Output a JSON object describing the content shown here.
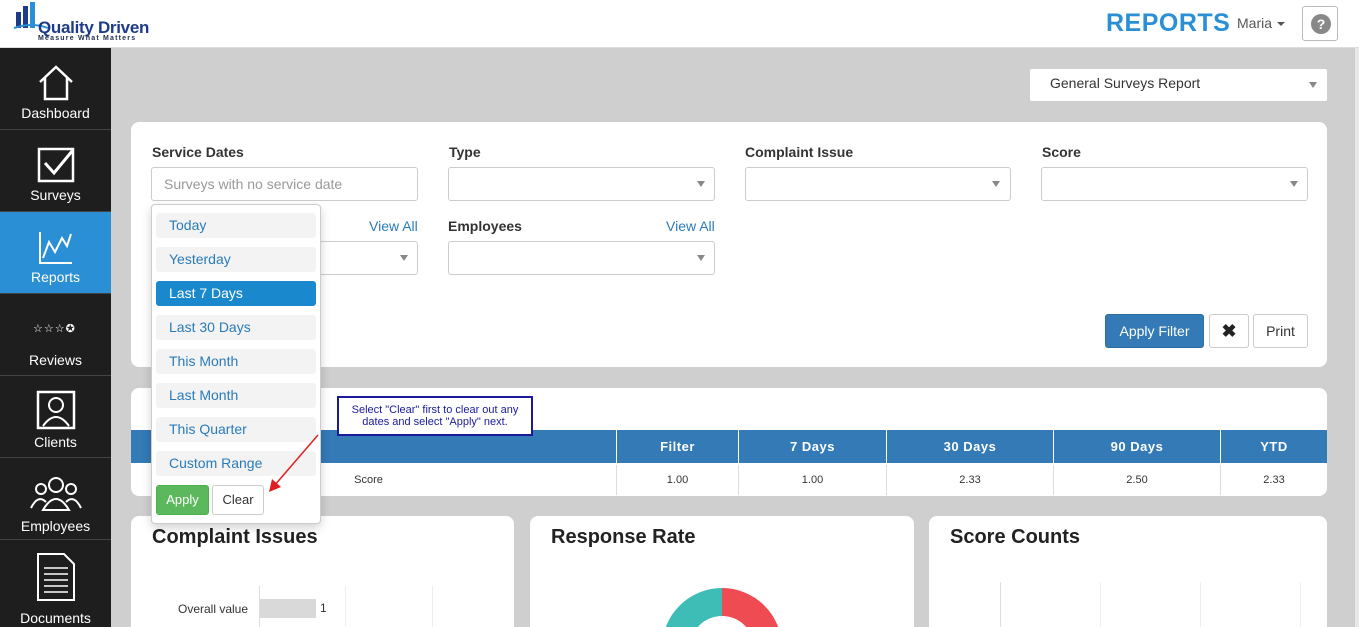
{
  "header": {
    "logo_text": "Quality Driven",
    "logo_tagline": "Measure What Matters",
    "title": "REPORTS",
    "user": "Maria",
    "help_icon": "question-circle-icon"
  },
  "sidebar": {
    "items": [
      {
        "label": "Dashboard",
        "icon": "home-icon"
      },
      {
        "label": "Surveys",
        "icon": "checkbox-icon"
      },
      {
        "label": "Reports",
        "icon": "chart-line-icon"
      },
      {
        "label": "Reviews",
        "icon": "stars-icon"
      },
      {
        "label": "Clients",
        "icon": "user-icon"
      },
      {
        "label": "Employees",
        "icon": "users-icon"
      },
      {
        "label": "Documents",
        "icon": "document-icon"
      }
    ],
    "active": "Reports"
  },
  "report_select": {
    "value": "General Surveys Report"
  },
  "filters": {
    "service_dates_label": "Service Dates",
    "service_dates_placeholder": "Surveys with no service date",
    "type_label": "Type",
    "complaint_issue_label": "Complaint Issue",
    "score_label": "Score",
    "view_all_1": "View All",
    "employees_label": "Employees",
    "view_all_2": "View All",
    "apply_filter": "Apply Filter",
    "clear_icon": "✖",
    "print": "Print"
  },
  "date_menu": {
    "items": [
      "Today",
      "Yesterday",
      "Last 7 Days",
      "Last 30 Days",
      "This Month",
      "Last Month",
      "This Quarter",
      "Custom Range"
    ],
    "selected": "Last 7 Days",
    "apply": "Apply",
    "clear": "Clear"
  },
  "callout": {
    "text": "Select \"Clear\" first to clear out any dates and select \"Apply\" next."
  },
  "score_table": {
    "headers": [
      "Filter",
      "7 Days",
      "30 Days",
      "90 Days",
      "YTD"
    ],
    "row_label": "Score",
    "values": [
      "1.00",
      "1.00",
      "2.33",
      "2.50",
      "2.33"
    ]
  },
  "cards": {
    "complaint_issues": {
      "title": "Complaint Issues",
      "bar_label": "Overall value",
      "bar_value": "1"
    },
    "response_rate": {
      "title": "Response Rate"
    },
    "score_counts": {
      "title": "Score Counts"
    }
  },
  "colors": {
    "accent": "#2b8fd6",
    "primary": "#337ab7",
    "apply_green": "#5cb85c",
    "donut_teal": "#3dbdb6",
    "donut_red": "#ef4b52"
  }
}
